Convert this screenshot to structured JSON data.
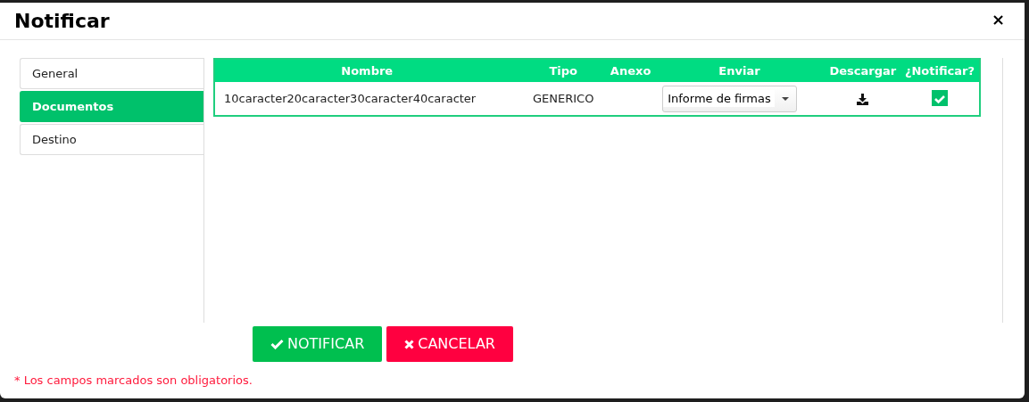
{
  "window": {
    "title": "Notificar",
    "close": "×"
  },
  "tabs": [
    {
      "label": "General",
      "selected": false
    },
    {
      "label": "Documentos",
      "selected": true
    },
    {
      "label": "Destino",
      "selected": false
    }
  ],
  "table": {
    "columns": [
      "Nombre",
      "Tipo",
      "Anexo",
      "Enviar",
      "Descargar",
      "¿Notificar?"
    ],
    "rows": [
      {
        "nombre": "10caracter20caracter30caracter40caracter",
        "tipo": "GENERICO",
        "enviar": "Informe de firmas",
        "notificar": true
      }
    ]
  },
  "buttons": [
    {
      "kind": "confirm",
      "label": "NOTIFICAR"
    },
    {
      "kind": "cancel",
      "label": "CANCELAR"
    }
  ],
  "footnote": "* Los campos marcados son obligatorios."
}
